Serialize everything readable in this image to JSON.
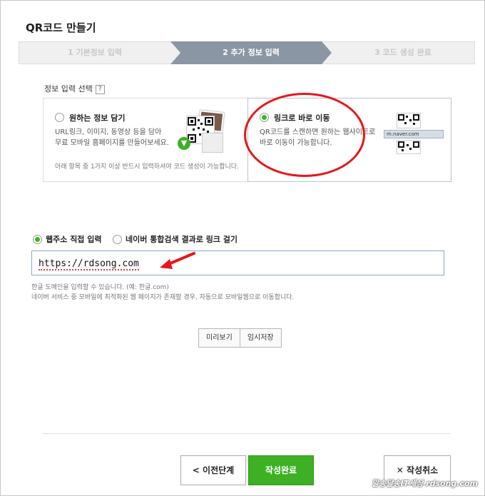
{
  "title": "QR코드 만들기",
  "steps": [
    {
      "label": "1 기본정보 입력",
      "active": false
    },
    {
      "label": "2 추가 정보 입력",
      "active": true
    },
    {
      "label": "3 코드 생성 완료",
      "active": false
    }
  ],
  "section": {
    "label": "정보 입력 선택",
    "help": "?"
  },
  "options": [
    {
      "title": "원하는 정보 담기",
      "desc_line1": "URL링크, 이미지, 동영상 등을 담아",
      "desc_line2": "무료 모바일 홈페이지를 만들어보세요.",
      "note": "아래 항목 중 1가지 이상 반드시 입력하셔야 코드 생성이 가능합니다.",
      "selected": false
    },
    {
      "title": "링크로 바로 이동",
      "desc_line1": "QR코드를 스캔하면 원하는 웹사이트로",
      "desc_line2": "바로 이동이 가능합니다.",
      "badge": "m.naver.com",
      "selected": true
    }
  ],
  "link_type": [
    {
      "label": "웹주소 직접 입력",
      "selected": true
    },
    {
      "label": "네이버 통합검색 결과로 링크 걸기",
      "selected": false
    }
  ],
  "url_value": "https://rdsong.com",
  "hints": [
    "한글 도메인을 입력할 수 있습니다. (예: 한글.com)",
    "네이버 서비스 중 모바일에 최적화된 웹 페이지가 존재할 경우, 자동으로 모바일웹으로 이동합니다."
  ],
  "preview_buttons": {
    "preview": "미리보기",
    "save_draft": "임시저장"
  },
  "footer_buttons": {
    "prev": "< 이전단계",
    "done": "작성완료",
    "cancel": "✕ 작성취소"
  },
  "watermark": "알송달송IT세상 rdsong.com",
  "colors": {
    "accent_green": "#3db023",
    "step_active": "#8a96a3",
    "annotation_red": "#e8161b"
  }
}
